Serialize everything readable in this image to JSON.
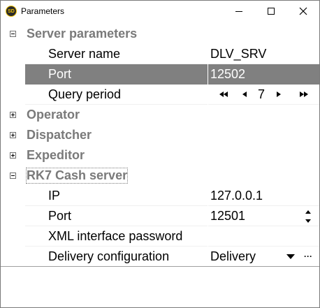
{
  "window": {
    "title": "Parameters",
    "app_icon_text": "SD"
  },
  "categories": [
    {
      "label": "Server parameters",
      "expanded": true,
      "properties": [
        {
          "name": "Server name",
          "value": "DLV_SRV"
        },
        {
          "name": "Port",
          "value": "12502",
          "selected": true
        },
        {
          "name": "Query period",
          "value": "7"
        }
      ]
    },
    {
      "label": "Operator",
      "expanded": false
    },
    {
      "label": "Dispatcher",
      "expanded": false
    },
    {
      "label": "Expeditor",
      "expanded": false
    },
    {
      "label": "RK7 Cash server",
      "expanded": true,
      "properties": [
        {
          "name": "IP",
          "value": "127.0.0.1"
        },
        {
          "name": "Port",
          "value": "12501"
        },
        {
          "name": "XML interface password",
          "value": ""
        },
        {
          "name": "Delivery configuration",
          "value": "Delivery",
          "ellipsis": "···"
        }
      ]
    }
  ]
}
